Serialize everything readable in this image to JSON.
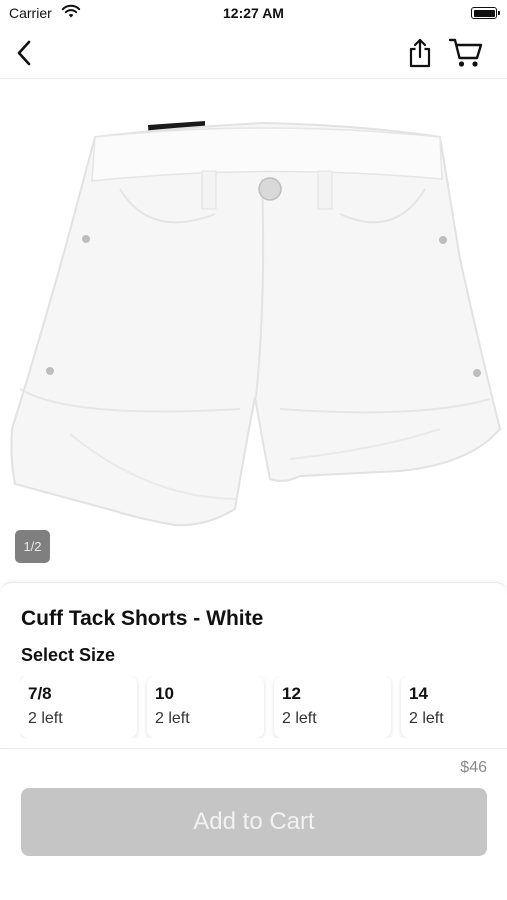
{
  "status_bar": {
    "carrier": "Carrier",
    "time": "12:27 AM"
  },
  "nav": {
    "back_icon": "chevron-left-icon",
    "share_icon": "share-icon",
    "cart_icon": "shopping-cart-icon"
  },
  "gallery": {
    "image_subject": "white denim shorts",
    "page_indicator": "1/2"
  },
  "product": {
    "title": "Cuff Tack Shorts - White",
    "select_size_label": "Select Size",
    "sizes": [
      {
        "size": "7/8",
        "stock": "2 left"
      },
      {
        "size": "10",
        "stock": "2 left"
      },
      {
        "size": "12",
        "stock": "2 left"
      },
      {
        "size": "14",
        "stock": "2 left"
      }
    ],
    "price": "$46"
  },
  "actions": {
    "add_to_cart_label": "Add to Cart"
  },
  "colors": {
    "button_disabled": "#c5c5c5",
    "page_indicator_bg": "#7f7f7f",
    "price_text": "#8a8a8a"
  }
}
